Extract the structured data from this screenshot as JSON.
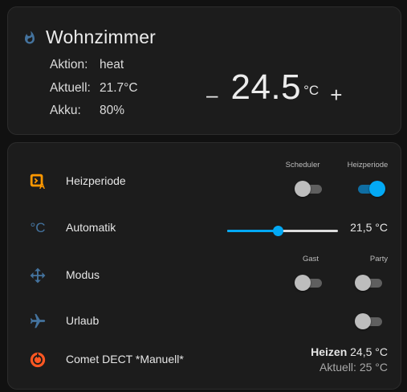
{
  "thermostat": {
    "name": "Wohnzimmer",
    "info": [
      {
        "label": "Aktion:",
        "value": "heat"
      },
      {
        "label": "Aktuell:",
        "value": "21.7°C"
      },
      {
        "label": "Akku:",
        "value": "80%"
      }
    ],
    "setpoint": "24.5",
    "unit": "°C",
    "minus": "–",
    "plus": "+"
  },
  "rows": {
    "heizperiode": {
      "label": "Heizperiode",
      "toggles": [
        {
          "header": "Scheduler",
          "on": false
        },
        {
          "header": "Heizperiode",
          "on": true
        }
      ]
    },
    "automatik": {
      "label": "Automatik",
      "icon_glyph": "°C",
      "slider_value": "21,5 °C",
      "slider_fraction": 0.46
    },
    "modus": {
      "label": "Modus",
      "toggles": [
        {
          "header": "Gast",
          "on": false
        },
        {
          "header": "Party",
          "on": false
        }
      ]
    },
    "urlaub": {
      "label": "Urlaub",
      "on": false
    },
    "comet": {
      "label": "Comet DECT *Manuell*",
      "state_bold": "Heizen",
      "state_value": "24,5 °C",
      "current": "Aktuell: 25 °C"
    }
  },
  "colors": {
    "accent": "#03a9f4",
    "icon_blue": "#44739e",
    "icon_orange": "#ff9800",
    "card_bg": "#1c1c1c"
  }
}
